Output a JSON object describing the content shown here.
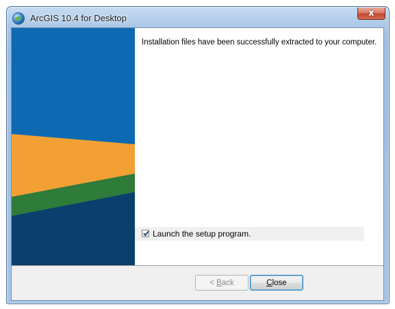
{
  "window": {
    "title": "ArcGIS 10.4 for Desktop",
    "close_glyph": "x"
  },
  "content": {
    "message": "Installation files have been successfully extracted to your computer.",
    "launch_checkbox": {
      "label": "Launch the setup program.",
      "checked": true
    }
  },
  "buttons": {
    "back": {
      "label_prefix": "< ",
      "mnemonic": "B",
      "label_rest": "ack",
      "enabled": false
    },
    "close": {
      "label_prefix": "",
      "mnemonic": "C",
      "label_rest": "lose",
      "enabled": true
    }
  },
  "icons": {
    "app": "arcgis-globe-icon",
    "close": "close-icon",
    "check": "checkmark-icon"
  },
  "colors": {
    "sidebar_blue": "#0d6ab2",
    "sidebar_orange": "#f2a033",
    "sidebar_green": "#2e7b3a",
    "sidebar_navy": "#0b3f6e"
  }
}
